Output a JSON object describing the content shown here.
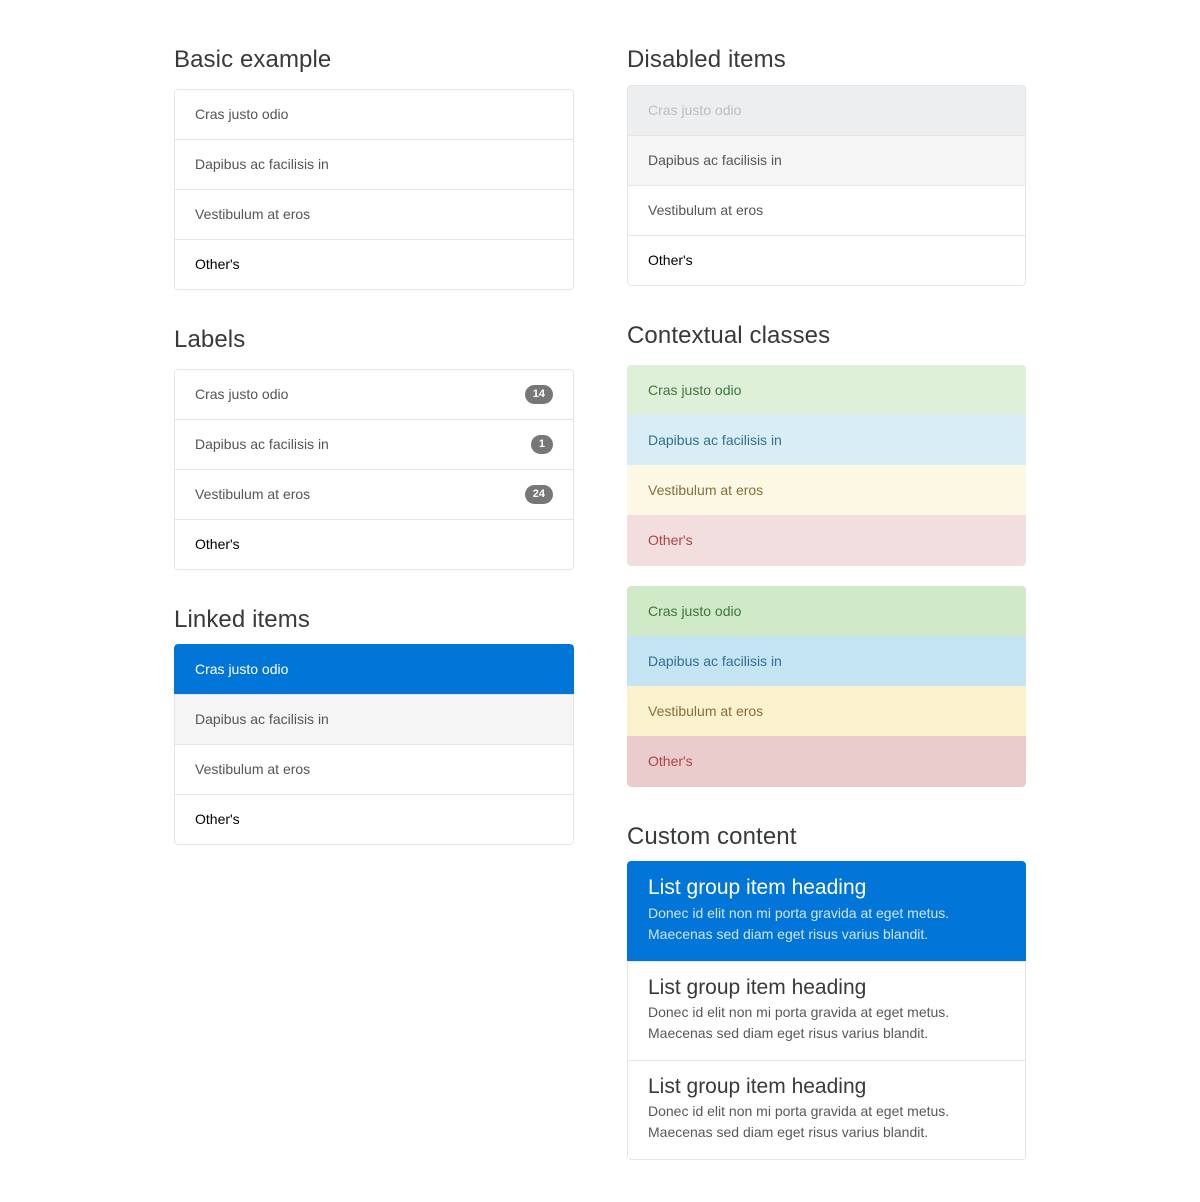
{
  "sections": {
    "basic": {
      "title": "Basic example",
      "items": [
        {
          "label": "Cras justo odio",
          "state": "default"
        },
        {
          "label": "Dapibus ac facilisis in",
          "state": "default"
        },
        {
          "label": "Vestibulum at eros",
          "state": "default"
        },
        {
          "label": "Other's",
          "state": "strong"
        }
      ]
    },
    "labels": {
      "title": "Labels",
      "items": [
        {
          "label": "Cras justo odio",
          "badge": "14",
          "state": "default"
        },
        {
          "label": "Dapibus ac facilisis in",
          "badge": "1",
          "state": "default"
        },
        {
          "label": "Vestibulum at eros",
          "badge": "24",
          "state": "default"
        },
        {
          "label": "Other's",
          "badge": "",
          "state": "strong"
        }
      ]
    },
    "linked": {
      "title": "Linked items",
      "items": [
        {
          "label": "Cras justo odio",
          "state": "active"
        },
        {
          "label": "Dapibus ac facilisis in",
          "state": "hover"
        },
        {
          "label": "Vestibulum at eros",
          "state": "default"
        },
        {
          "label": "Other's",
          "state": "strong"
        }
      ]
    },
    "disabled": {
      "title": "Disabled items",
      "items": [
        {
          "label": "Cras justo odio",
          "state": "disabled"
        },
        {
          "label": "Dapibus ac facilisis in",
          "state": "hover"
        },
        {
          "label": "Vestibulum at eros",
          "state": "default"
        },
        {
          "label": "Other's",
          "state": "strong"
        }
      ]
    },
    "contextual": {
      "title": "Contextual classes",
      "group_one": [
        {
          "label": "Cras justo odio",
          "variant": "success"
        },
        {
          "label": "Dapibus ac facilisis in",
          "variant": "info"
        },
        {
          "label": "Vestibulum at eros",
          "variant": "warning"
        },
        {
          "label": "Other's",
          "variant": "danger"
        }
      ],
      "group_two": [
        {
          "label": "Cras justo odio",
          "variant": "success-hover"
        },
        {
          "label": "Dapibus ac facilisis in",
          "variant": "info-hover"
        },
        {
          "label": "Vestibulum at eros",
          "variant": "warning-hover"
        },
        {
          "label": "Other's",
          "variant": "danger-hover"
        }
      ]
    },
    "custom": {
      "title": "Custom content",
      "items": [
        {
          "heading": "List group item heading",
          "line1": "Donec id elit non mi porta gravida at eget metus.",
          "line2": "Maecenas sed diam eget risus varius blandit.",
          "state": "active"
        },
        {
          "heading": "List group item heading",
          "line1": "Donec id elit non mi porta gravida at eget metus.",
          "line2": "Maecenas sed diam eget risus varius blandit.",
          "state": "default"
        },
        {
          "heading": "List group item heading",
          "line1": "Donec id elit non mi porta gravida at eget metus.",
          "line2": "Maecenas sed diam eget risus varius blandit.",
          "state": "default"
        }
      ]
    }
  },
  "colors": {
    "primary": "#0275d8",
    "badge_bg": "#777777",
    "border": "#e5e5e5",
    "hover_bg": "#f5f5f5",
    "disabled_bg": "#eceeef",
    "disabled_text": "#b7c0c5",
    "success_bg": "#dff0d8",
    "success_text": "#3c763d",
    "info_bg": "#d9edf7",
    "info_text": "#31708f",
    "warning_bg": "#fcf8e3",
    "warning_text": "#8a6d3b",
    "danger_bg": "#f2dede",
    "danger_text": "#a94442",
    "success_bg_hover": "#d0e9c6",
    "info_bg_hover": "#c4e3f3",
    "warning_bg_hover": "#faf2cc",
    "danger_bg_hover": "#ebcccc"
  }
}
